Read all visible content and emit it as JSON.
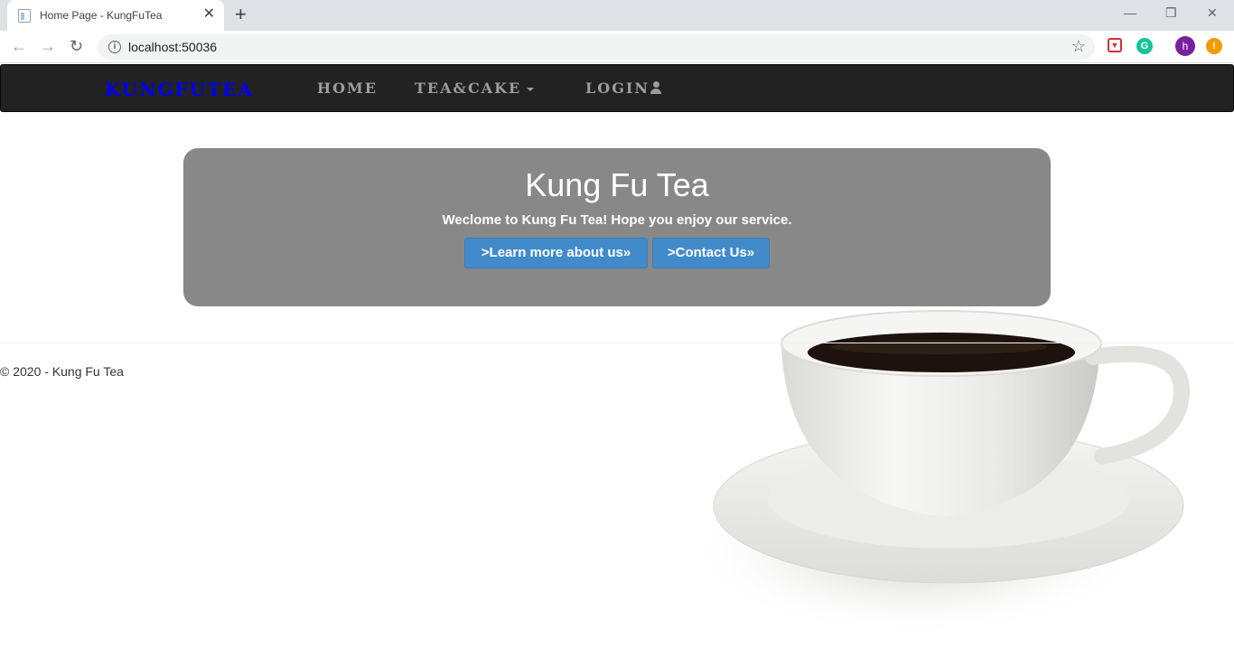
{
  "browser": {
    "tab_title": "Home Page - KungFuTea",
    "tab_close": "✕",
    "new_tab": "+",
    "url": "localhost:50036",
    "profile_initial": "h",
    "alert_badge": "!",
    "controls": {
      "minimize": "—",
      "restore": "❐",
      "close": "✕"
    }
  },
  "navbar": {
    "brand": "KungFuTea",
    "links": [
      {
        "label": "Home"
      },
      {
        "label": "Tea&Cake"
      },
      {
        "label": "Login"
      }
    ]
  },
  "jumbotron": {
    "title": "Kung Fu Tea",
    "lead": "Weclome to Kung Fu Tea! Hope you enjoy our service.",
    "buttons": [
      {
        "label": ">Learn more about us»"
      },
      {
        "label": ">Contact Us»"
      }
    ]
  },
  "footer": {
    "text": "© 2020 - Kung Fu Tea"
  },
  "colors": {
    "navbar_bg": "#222222",
    "brand": "#0000ff",
    "jumbotron_bg": "#888888",
    "button": "#428bca"
  },
  "icons": [
    "back-arrow-icon",
    "forward-arrow-icon",
    "reload-icon",
    "info-icon",
    "star-icon",
    "user-icon",
    "caret-down-icon"
  ]
}
